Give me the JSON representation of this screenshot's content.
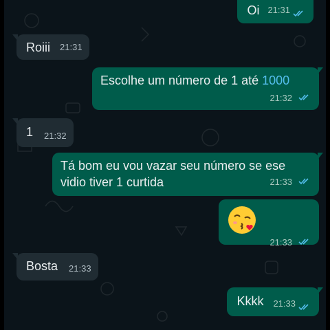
{
  "messages": [
    {
      "direction": "out",
      "text": "Oi",
      "time": "21:31",
      "status": "read"
    },
    {
      "direction": "in",
      "text": "Roiii",
      "time": "21:31"
    },
    {
      "direction": "out",
      "text_before": "Escolhe um número de 1 até ",
      "text_highlight": "1000",
      "time": "21:32",
      "status": "read"
    },
    {
      "direction": "in",
      "text": "1",
      "time": "21:32"
    },
    {
      "direction": "out",
      "text_line1": "Tá bom eu vou vazar seu número se ese",
      "text_line2": "vidio tiver 1 curtida",
      "time": "21:33",
      "status": "read"
    },
    {
      "direction": "out",
      "emoji": "kissing-face-with-heart",
      "time": "21:33",
      "status": "read"
    },
    {
      "direction": "in",
      "text": "Bosta",
      "time": "21:33"
    },
    {
      "direction": "out",
      "text": "Kkkk",
      "time": "21:33",
      "status": "read"
    }
  ],
  "colors": {
    "background": "#0b141a",
    "incoming_bubble": "#202c33",
    "outgoing_bubble": "#005c4b",
    "read_ticks": "#53bdeb",
    "link": "#53bdeb"
  }
}
